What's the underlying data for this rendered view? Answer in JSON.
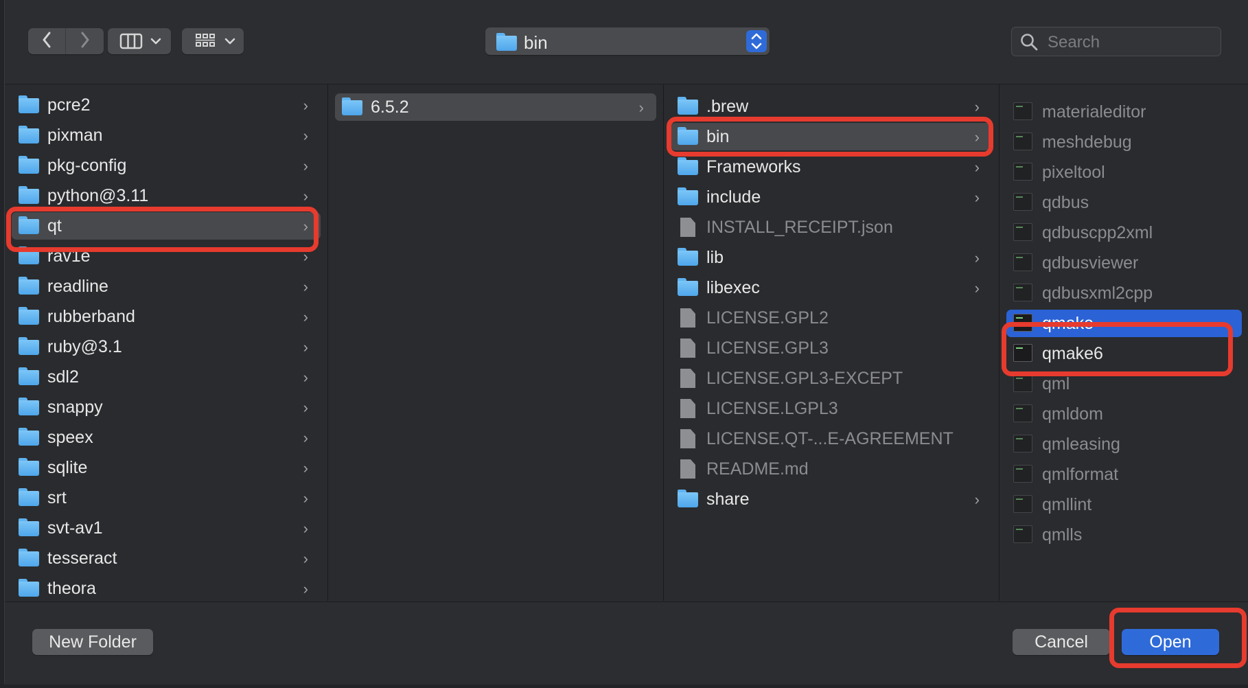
{
  "toolbar": {
    "back_icon": "chevron-left-icon",
    "forward_icon": "chevron-right-icon",
    "view_icon": "column-view-icon",
    "group_icon": "grid-group-icon",
    "path_popup_value": "bin",
    "search_placeholder": "Search"
  },
  "columns": {
    "col1": [
      {
        "label": "pcre2",
        "kind": "folder",
        "arrow": true
      },
      {
        "label": "pixman",
        "kind": "folder",
        "arrow": true
      },
      {
        "label": "pkg-config",
        "kind": "folder",
        "arrow": true
      },
      {
        "label": "python@3.11",
        "kind": "folder",
        "arrow": true
      },
      {
        "label": "qt",
        "kind": "folder",
        "arrow": true,
        "state": "selected-gray"
      },
      {
        "label": "rav1e",
        "kind": "folder",
        "arrow": true
      },
      {
        "label": "readline",
        "kind": "folder",
        "arrow": true
      },
      {
        "label": "rubberband",
        "kind": "folder",
        "arrow": true
      },
      {
        "label": "ruby@3.1",
        "kind": "folder",
        "arrow": true
      },
      {
        "label": "sdl2",
        "kind": "folder",
        "arrow": true
      },
      {
        "label": "snappy",
        "kind": "folder",
        "arrow": true
      },
      {
        "label": "speex",
        "kind": "folder",
        "arrow": true
      },
      {
        "label": "sqlite",
        "kind": "folder",
        "arrow": true
      },
      {
        "label": "srt",
        "kind": "folder",
        "arrow": true
      },
      {
        "label": "svt-av1",
        "kind": "folder",
        "arrow": true
      },
      {
        "label": "tesseract",
        "kind": "folder",
        "arrow": true
      },
      {
        "label": "theora",
        "kind": "folder",
        "arrow": true
      }
    ],
    "col2": [
      {
        "label": "6.5.2",
        "kind": "folder",
        "arrow": true,
        "state": "selected-gray"
      }
    ],
    "col3": [
      {
        "label": ".brew",
        "kind": "folder",
        "arrow": true
      },
      {
        "label": "bin",
        "kind": "folder",
        "arrow": true,
        "state": "selected-gray"
      },
      {
        "label": "Frameworks",
        "kind": "folder",
        "arrow": true
      },
      {
        "label": "include",
        "kind": "folder",
        "arrow": true
      },
      {
        "label": "INSTALL_RECEIPT.json",
        "kind": "doc",
        "dim": true
      },
      {
        "label": "lib",
        "kind": "folder",
        "arrow": true
      },
      {
        "label": "libexec",
        "kind": "folder",
        "arrow": true
      },
      {
        "label": "LICENSE.GPL2",
        "kind": "doc",
        "dim": true
      },
      {
        "label": "LICENSE.GPL3",
        "kind": "doc",
        "dim": true
      },
      {
        "label": "LICENSE.GPL3-EXCEPT",
        "kind": "doc",
        "dim": true
      },
      {
        "label": "LICENSE.LGPL3",
        "kind": "doc",
        "dim": true
      },
      {
        "label": "LICENSE.QT-...E-AGREEMENT",
        "kind": "doc",
        "dim": true
      },
      {
        "label": "README.md",
        "kind": "doc",
        "dim": true
      },
      {
        "label": "share",
        "kind": "folder",
        "arrow": true
      }
    ],
    "col4": [
      {
        "label": "materialeditor",
        "kind": "exe",
        "dim": true
      },
      {
        "label": "meshdebug",
        "kind": "exe",
        "dim": true
      },
      {
        "label": "pixeltool",
        "kind": "exe",
        "dim": true
      },
      {
        "label": "qdbus",
        "kind": "exe",
        "dim": true
      },
      {
        "label": "qdbuscpp2xml",
        "kind": "exe",
        "dim": true
      },
      {
        "label": "qdbusviewer",
        "kind": "exe",
        "dim": true
      },
      {
        "label": "qdbusxml2cpp",
        "kind": "exe",
        "dim": true
      },
      {
        "label": "qmake",
        "kind": "exe",
        "state": "selected-blue"
      },
      {
        "label": "qmake6",
        "kind": "exe"
      },
      {
        "label": "qml",
        "kind": "exe",
        "dim": true
      },
      {
        "label": "qmldom",
        "kind": "exe",
        "dim": true
      },
      {
        "label": "qmleasing",
        "kind": "exe",
        "dim": true
      },
      {
        "label": "qmlformat",
        "kind": "exe",
        "dim": true
      },
      {
        "label": "qmllint",
        "kind": "exe",
        "dim": true
      },
      {
        "label": "qmlls",
        "kind": "exe",
        "dim": true
      }
    ]
  },
  "buttons": {
    "new_folder": "New Folder",
    "cancel": "Cancel",
    "open": "Open"
  },
  "colors": {
    "background": "#2a2b2e",
    "selection_blue": "#2b62d6",
    "selection_gray": "#48494c",
    "highlight_annotation": "#e63b2e",
    "folder_blue": "#5fb3f0"
  }
}
